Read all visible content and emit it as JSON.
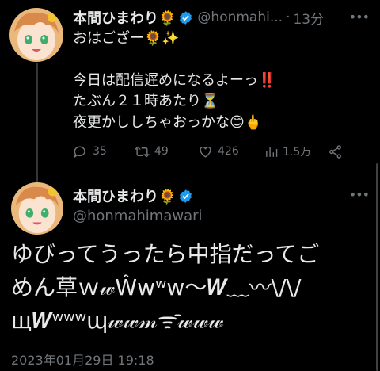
{
  "tweet1": {
    "display_name": "本間ひまわり🌻",
    "handle": "@honmahi...",
    "separator": "·",
    "time": "13分",
    "lines": [
      "おはござー🌻✨",
      "",
      "今日は配信遅めになるよーっ‼️",
      "たぶん２１時あたり⏳",
      "夜更かししちゃおっかな😊🖕"
    ],
    "actions": {
      "replies": "35",
      "retweets": "49",
      "likes": "426",
      "views": "1.5万"
    }
  },
  "tweet2": {
    "display_name": "本間ひまわり🌻",
    "handle": "@honmahimawari",
    "lines": [
      "ゆびってうったら中指だってご",
      "めん草ｗ𝓌Ŵwʷw〜𝑾﹏〰\\/\\/",
      "щ𝑾ʷʷʷɰ𝓌𝓌𝓂ᯤᯰ𝓌𝓌𝓌"
    ],
    "date": "2023年01月29日 19:18"
  },
  "colors": {
    "background": "#000000",
    "text": "#e7e9ea",
    "muted": "#71767b",
    "verified": "#1d9bf0"
  }
}
